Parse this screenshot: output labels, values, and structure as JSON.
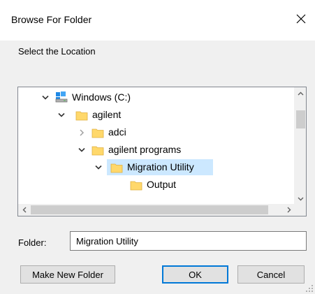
{
  "window": {
    "title": "Browse For Folder",
    "close_icon": "close-icon"
  },
  "dialog": {
    "instruction": "Select the Location"
  },
  "tree": {
    "nodes": [
      {
        "label": "Windows (C:)",
        "icon": "drive-icon",
        "expander": "expanded",
        "selected": false
      },
      {
        "label": "agilent",
        "icon": "folder-icon",
        "expander": "expanded",
        "selected": false
      },
      {
        "label": "adci",
        "icon": "folder-icon",
        "expander": "collapsed",
        "selected": false
      },
      {
        "label": "agilent programs",
        "icon": "folder-icon",
        "expander": "expanded",
        "selected": false
      },
      {
        "label": "Migration Utility",
        "icon": "folder-icon",
        "expander": "expanded",
        "selected": true
      },
      {
        "label": "Output",
        "icon": "folder-icon",
        "expander": "none",
        "selected": false
      }
    ]
  },
  "folder": {
    "label": "Folder:",
    "value": "Migration Utility"
  },
  "buttons": {
    "make_new_folder": "Make New Folder",
    "ok": "OK",
    "cancel": "Cancel"
  },
  "colors": {
    "selection": "#cce8ff",
    "folder_fill": "#ffd86b",
    "folder_edge": "#e0b040",
    "default_button_border": "#0078d7"
  }
}
